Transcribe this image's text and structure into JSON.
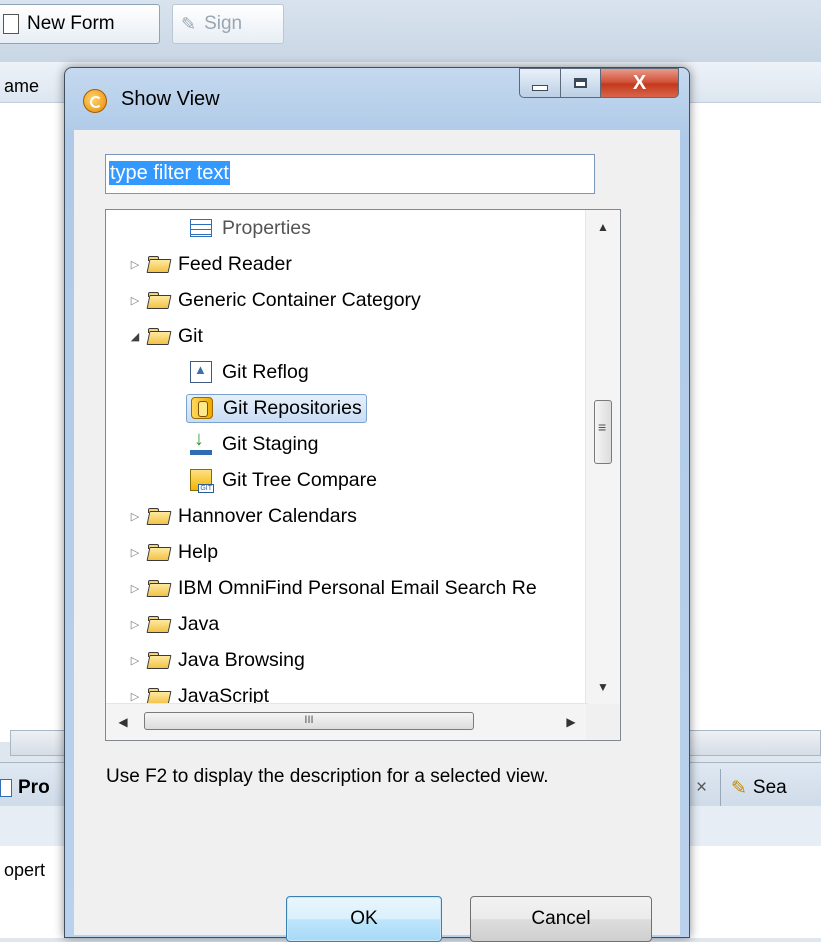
{
  "background": {
    "toolbar": {
      "new_form_label": "New Form",
      "sign_label": "Sign"
    },
    "editor": {
      "column_fragment": "ame"
    },
    "panel_tabs": {
      "properties_fragment": "Pro",
      "search_fragment": "Sea",
      "close_glyph": "×"
    },
    "lower_text_fragment": "opert"
  },
  "dialog": {
    "title": "Show View",
    "caption_buttons": {
      "minimize": "minimize",
      "maximize": "maximize",
      "close": "X"
    },
    "filter": {
      "value": "type filter text"
    },
    "tree": {
      "items": [
        {
          "label": "Properties",
          "type": "view",
          "icon": "properties-view-icon",
          "level": 1
        },
        {
          "label": "Feed Reader",
          "type": "category",
          "expanded": false
        },
        {
          "label": "Generic Container Category",
          "type": "category",
          "expanded": false
        },
        {
          "label": "Git",
          "type": "category",
          "expanded": true
        },
        {
          "label": "Git Reflog",
          "type": "view",
          "icon": "git-reflog-icon",
          "level": 1
        },
        {
          "label": "Git Repositories",
          "type": "view",
          "icon": "git-repositories-icon",
          "level": 1,
          "selected": true
        },
        {
          "label": "Git Staging",
          "type": "view",
          "icon": "git-staging-icon",
          "level": 1
        },
        {
          "label": "Git Tree Compare",
          "type": "view",
          "icon": "git-tree-compare-icon",
          "level": 1
        },
        {
          "label": "Hannover Calendars",
          "type": "category",
          "expanded": false
        },
        {
          "label": "Help",
          "type": "category",
          "expanded": false
        },
        {
          "label": "IBM OmniFind Personal Email Search Re",
          "type": "category",
          "expanded": false
        },
        {
          "label": "Java",
          "type": "category",
          "expanded": false
        },
        {
          "label": "Java Browsing",
          "type": "category",
          "expanded": false
        },
        {
          "label": "JavaScript",
          "type": "category",
          "expanded": false
        }
      ],
      "scroll_thumb_glyph": "III"
    },
    "hint": "Use F2 to display the description for a selected view.",
    "buttons": {
      "ok": "OK",
      "cancel": "Cancel"
    }
  }
}
